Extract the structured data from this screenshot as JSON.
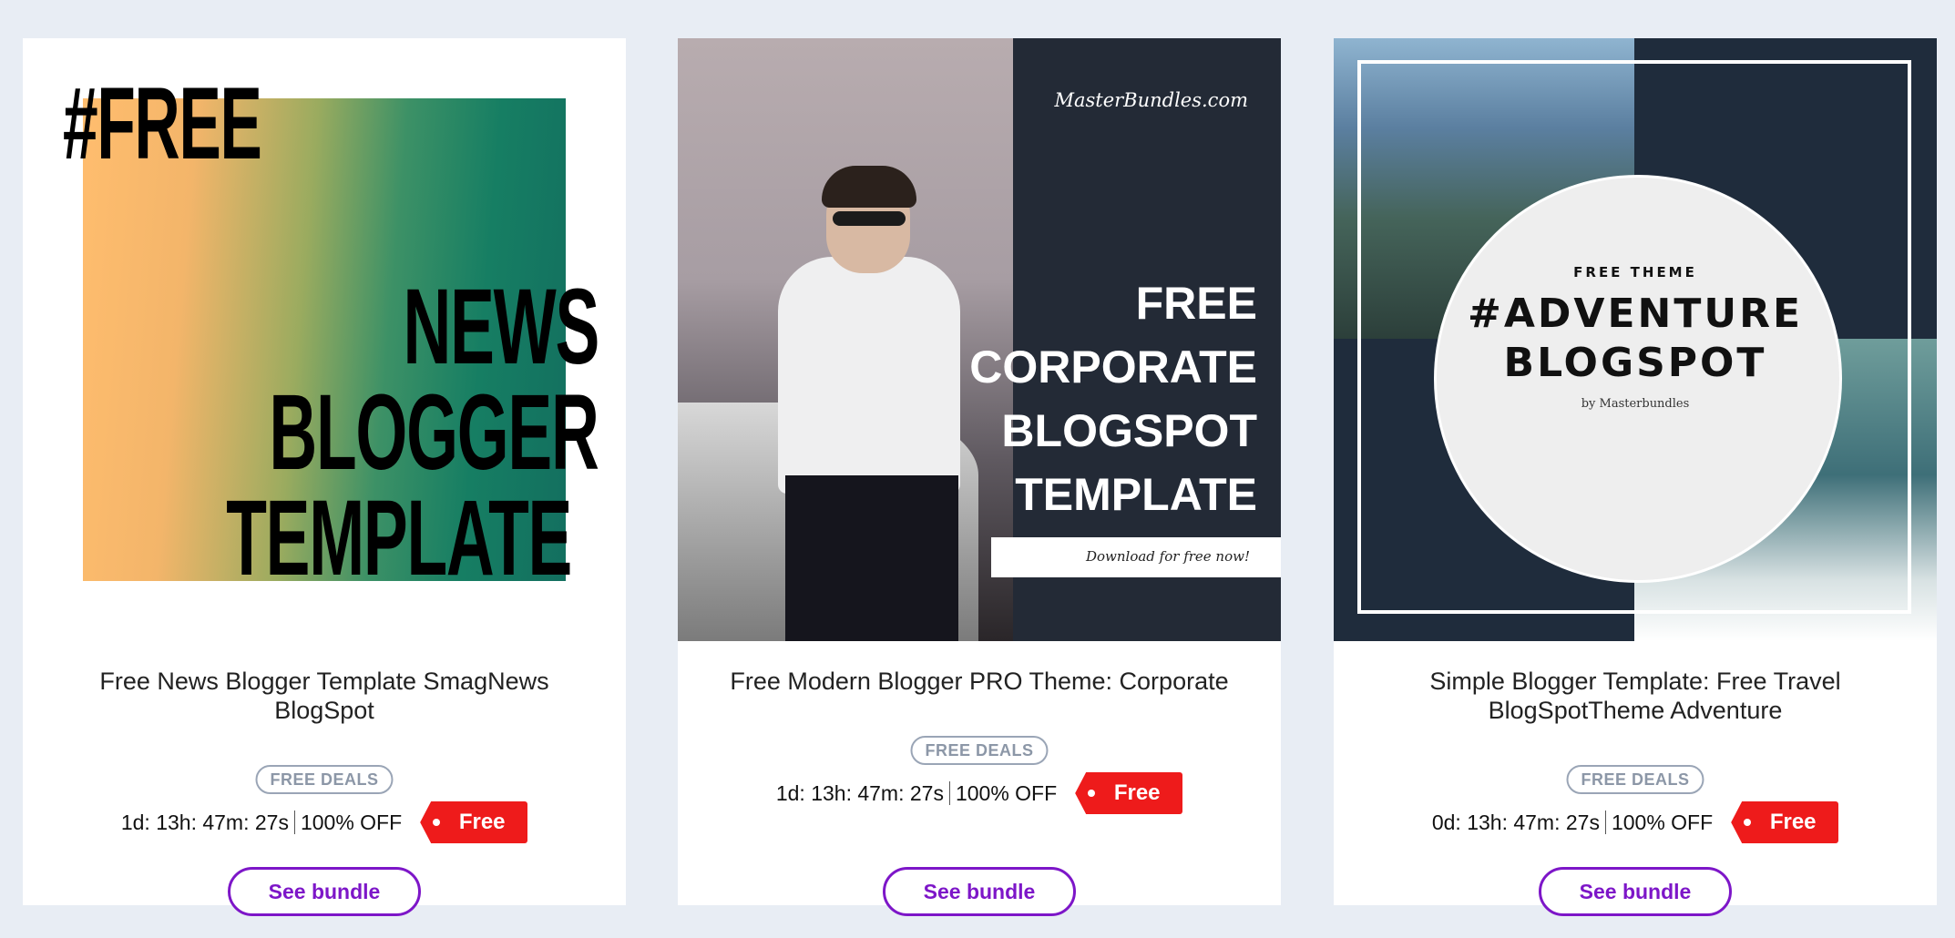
{
  "cards": [
    {
      "thumbnail": {
        "hashtag": "#FREE",
        "lines": [
          "NEWS",
          "BLOGGER",
          "TEMPLATE"
        ]
      },
      "title": "Free News Blogger Template SmagNews BlogSpot",
      "badge": "FREE DEALS",
      "countdown": "1d: 13h: 47m: 27s",
      "discount": "100% OFF",
      "price_tag": "Free",
      "button": "See bundle"
    },
    {
      "thumbnail": {
        "site": "MasterBundles.com",
        "lines": [
          "FREE",
          "CORPORATE",
          "BLOGSPOT",
          "TEMPLATE"
        ],
        "cta": "Download for free now!"
      },
      "title": "Free Modern Blogger PRO Theme: Corporate",
      "badge": "FREE DEALS",
      "countdown": "1d: 13h: 47m: 27s",
      "discount": "100% OFF",
      "price_tag": "Free",
      "button": "See bundle"
    },
    {
      "thumbnail": {
        "kicker": "FREE THEME",
        "lines": [
          "#ADVENTURE",
          "BLOGSPOT"
        ],
        "byline": "by Masterbundles"
      },
      "title": "Simple Blogger Template: Free Travel BlogSpotTheme Adventure",
      "badge": "FREE DEALS",
      "countdown": "0d: 13h: 47m: 27s",
      "discount": "100% OFF",
      "price_tag": "Free",
      "button": "See bundle"
    }
  ],
  "colors": {
    "page_bg": "#e8edf4",
    "accent_purple": "#7d16c8",
    "tag_red": "#ee1b1b",
    "badge_gray": "#8c97a7"
  },
  "icons": [
    "price-tag-icon"
  ]
}
